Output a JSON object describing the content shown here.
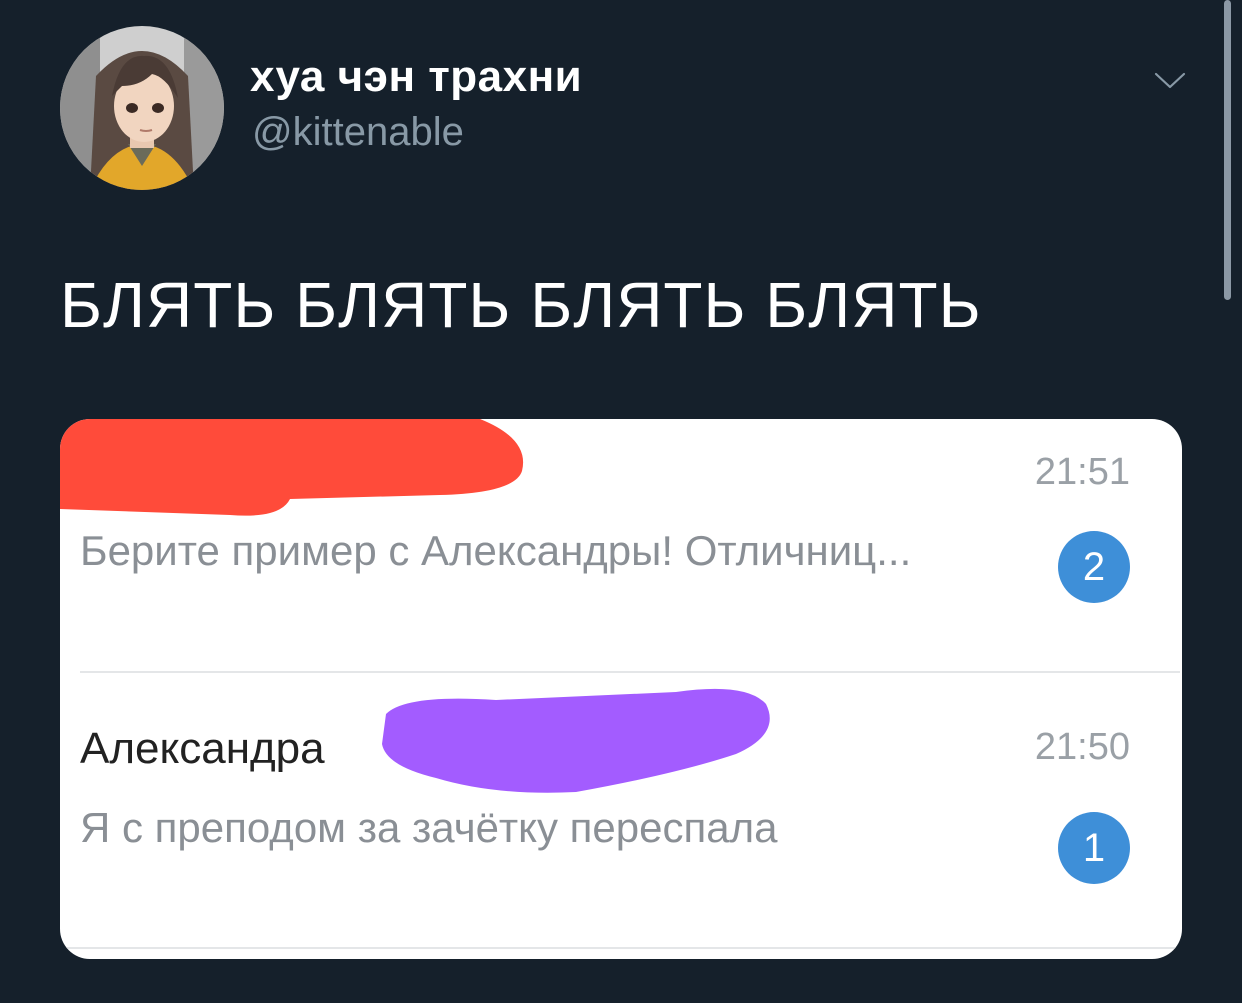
{
  "tweet": {
    "author": {
      "display_name": "хуа чэн трахни",
      "handle": "@kittenable",
      "avatar_icon": "avatar-anime-character"
    },
    "more_icon": "chevron-down-icon",
    "text": "БЛЯТЬ БЛЯТЬ БЛЯТЬ БЛЯТЬ"
  },
  "media": {
    "chats": [
      {
        "sender": "",
        "time": "21:51",
        "preview": "Берите пример с Александры! Отличниц...",
        "unread": "2",
        "redaction_color": "#ff4b3a"
      },
      {
        "sender": "Александра",
        "time": "21:50",
        "preview": "Я с преподом за зачётку переспала",
        "unread": "1",
        "redaction_color": "#a35cff"
      }
    ]
  },
  "colors": {
    "background": "#15202b",
    "secondary_text": "#8899a6",
    "badge": "#3e8fd8"
  }
}
